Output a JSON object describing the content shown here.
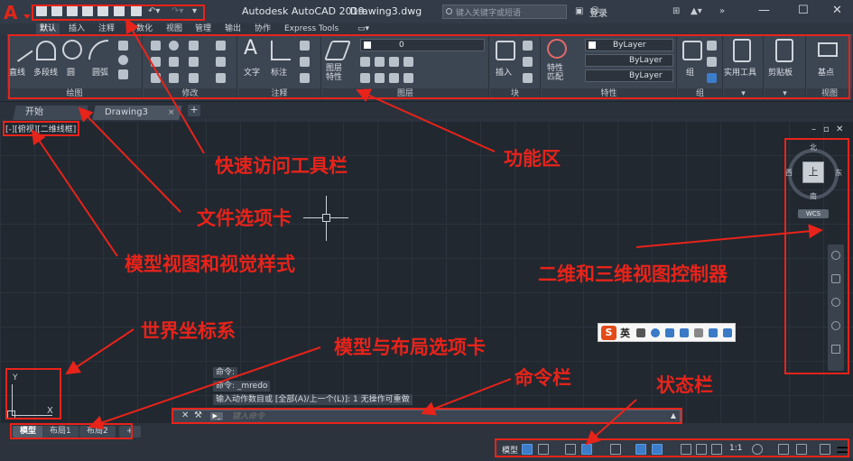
{
  "window": {
    "app_title": "Autodesk AutoCAD 2019",
    "file_name": "Drawing3.dwg",
    "search_placeholder": "键入关键字或短语",
    "login_label": "登录",
    "logo_letter": "A"
  },
  "ribbon_tabs": [
    "默认",
    "插入",
    "注释",
    "参数化",
    "视图",
    "管理",
    "输出",
    "协作",
    "Express Tools"
  ],
  "ribbon": {
    "draw": {
      "title": "绘图",
      "tools": [
        "直线",
        "多段线",
        "圆",
        "圆弧"
      ]
    },
    "modify": {
      "title": "修改"
    },
    "annotation": {
      "title": "注释",
      "tools": [
        "文字",
        "标注"
      ]
    },
    "layers": {
      "title": "图层",
      "tool": "图层\n特性",
      "layer_value": "0"
    },
    "block": {
      "title": "块",
      "tool": "插入"
    },
    "properties": {
      "title": "特性",
      "tool": "特性\n匹配",
      "bylayer": [
        "ByLayer",
        "ByLayer",
        "ByLayer"
      ]
    },
    "groups": {
      "title": "组",
      "tool": "组"
    },
    "utilities": {
      "tool": "实用工具"
    },
    "clipboard": {
      "tool": "剪贴板"
    },
    "view": {
      "title": "视图",
      "tool": "基点"
    }
  },
  "file_tabs": [
    {
      "label": "开始"
    },
    {
      "label": "Drawing3",
      "close": "×"
    }
  ],
  "tab_add": "+",
  "viewport": {
    "controls": "[-][俯视][二维线框]",
    "viewcube": {
      "top": "上",
      "north": "北",
      "south": "南",
      "east": "东",
      "west": "西",
      "wcs": "WCS"
    }
  },
  "ucs": {
    "x": "X",
    "y": "Y"
  },
  "ime": {
    "lang": "英",
    "logo": "S"
  },
  "command": {
    "history": [
      "命令:",
      "命令: _mredo",
      "输入动作数目或 [全部(A)/上一个(L)]: 1 无操作可重做"
    ],
    "placeholder": "键入命令"
  },
  "layout_tabs": [
    "模型",
    "布局1",
    "布局2"
  ],
  "status_bar": {
    "model": "模型",
    "scale": "1:1"
  },
  "annotations": {
    "quick_access": "快速访问工具栏",
    "ribbon": "功能区",
    "file_tabs": "文件选项卡",
    "model_view": "模型视图和视觉样式",
    "viewcube": "二维和三维视图控制器",
    "ucs": "世界坐标系",
    "layout": "模型与布局选项卡",
    "command_bar": "命令栏",
    "status_bar": "状态栏"
  },
  "colors": {
    "annotation": "#e8231a",
    "canvas": "#212830",
    "ribbon": "#3c4552",
    "accent": "#3b7dc9"
  }
}
